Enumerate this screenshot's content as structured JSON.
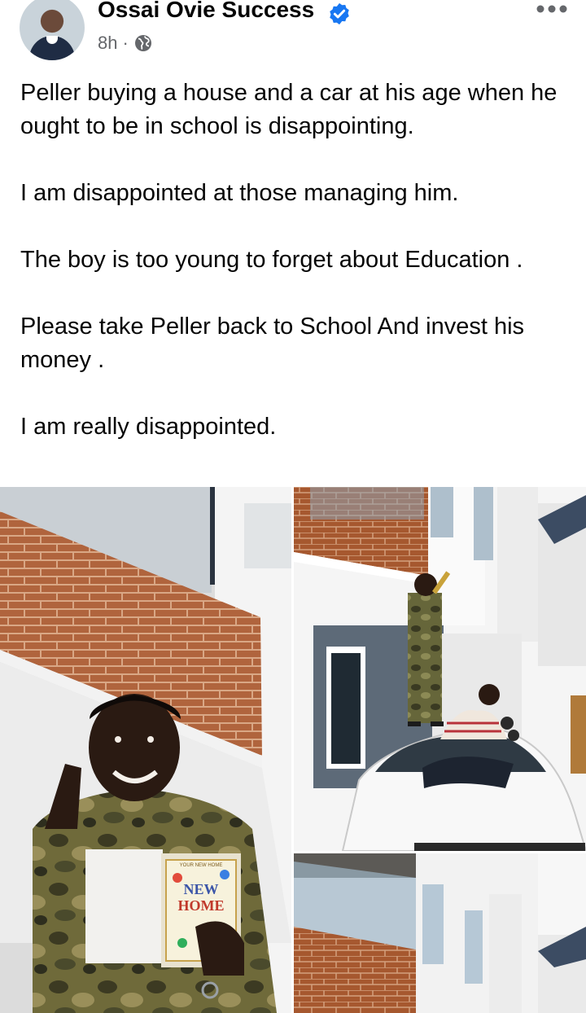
{
  "post": {
    "author": "Ossai Ovie Success",
    "time": "8h",
    "separator": "·",
    "paragraphs": [
      "Peller buying a house and a car at his age when he ought to be in school is disappointing.",
      "I am disappointed at those managing him.",
      "The boy is too young to forget about Education .",
      "Please take Peller back to School And invest his money .",
      "I am really disappointed."
    ]
  },
  "icons": {
    "verified": "verified-badge-icon",
    "privacy": "globe-icon",
    "menu": "more-options-icon"
  },
  "card": {
    "top": "YOUR NEW HOME",
    "line1": "NEW",
    "line2": "HOME"
  },
  "colors": {
    "verified": "#1877f2",
    "secondary_text": "#65676b",
    "primary_text": "#050505"
  }
}
